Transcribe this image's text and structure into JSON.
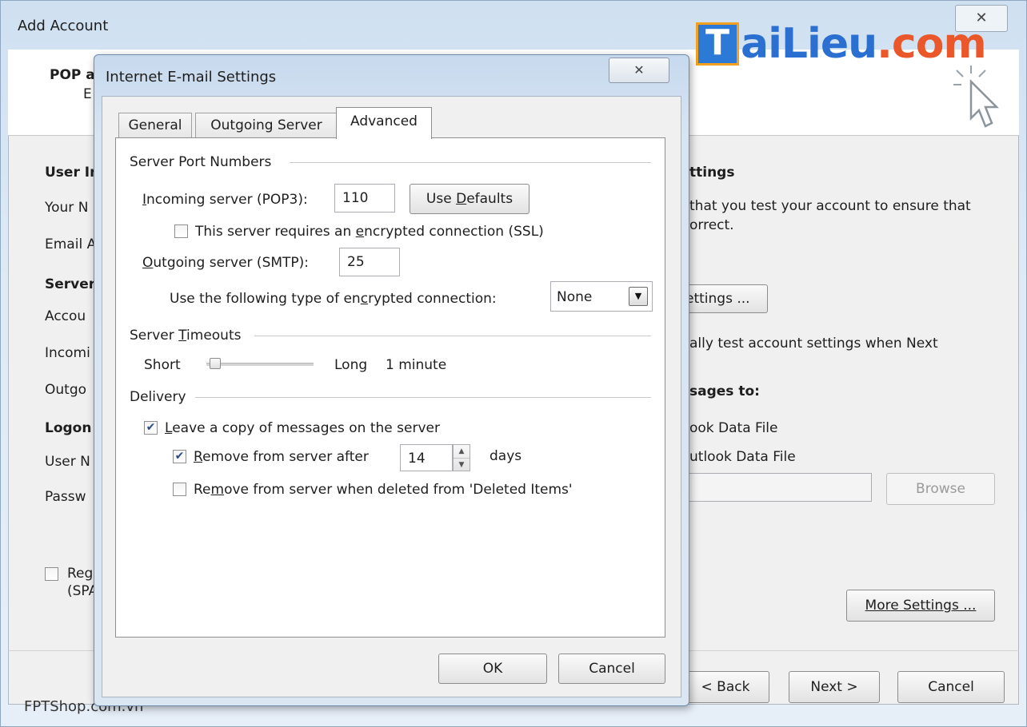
{
  "outer": {
    "title": "Add Account",
    "close_glyph": "✕",
    "header_title": "POP a",
    "header_sub": "E",
    "left_labels": {
      "user_info": "User In",
      "your_name": "Your N",
      "email": "Email A",
      "server": "Server",
      "account_type": "Accou",
      "incoming": "Incomi",
      "outgoing": "Outgo",
      "logon": "Logon",
      "user_name": "User N",
      "password": "Passw",
      "spa_line1": "Reg",
      "spa_line2": "(SPA"
    },
    "right_texts": {
      "settings_heading": "ttings",
      "test_line1": "that you test your account to ensure that",
      "test_line2": "orrect.",
      "test_button": "ettings ...",
      "auto_test": "ally test account settings when Next",
      "deliver_heading": "sages to:",
      "new_data_file": "ook Data File",
      "existing_data_file": "utlook Data File",
      "browse": "Browse",
      "more_settings": "More Settings ..."
    },
    "footer": {
      "back": "< Back",
      "next": "Next >",
      "cancel": "Cancel"
    },
    "watermark": "FPTShop.com.vn"
  },
  "logo": {
    "box_letter": "T",
    "text_main": "aiLieu",
    "text_suffix": ".com"
  },
  "dialog": {
    "title": "Internet E-mail Settings",
    "close_glyph": "✕",
    "tabs": [
      "General",
      "Outgoing Server",
      "Advanced"
    ],
    "active_tab": "Advanced",
    "ports_group": "Server Port Numbers",
    "incoming_label": "Incoming server (POP3):",
    "incoming_value": "110",
    "use_defaults": "Use Defaults",
    "ssl_label": "This server requires an encrypted connection (SSL)",
    "ssl_checked": false,
    "outgoing_label": "Outgoing server (SMTP):",
    "outgoing_value": "25",
    "encrypt_label": "Use the following type of encrypted connection:",
    "encrypt_value": "None",
    "timeouts_group": "Server Timeouts",
    "timeout_short": "Short",
    "timeout_long": "Long",
    "timeout_value": "1 minute",
    "delivery_group": "Delivery",
    "leave_copy_label": "Leave a copy of messages on the server",
    "leave_copy_checked": true,
    "remove_after_label": "Remove from server after",
    "remove_after_checked": true,
    "remove_after_days": "14",
    "days_label": "days",
    "remove_deleted_label": "Remove from server when deleted from 'Deleted Items'",
    "remove_deleted_checked": false,
    "ok": "OK",
    "cancel": "Cancel"
  },
  "colors": {
    "titlebar": "#cfe0f1",
    "dialog_frame": "#d7e4f2",
    "client_bg": "#f0f0f0",
    "logo_blue": "#2b6fd0",
    "logo_orange": "#e9572a"
  }
}
